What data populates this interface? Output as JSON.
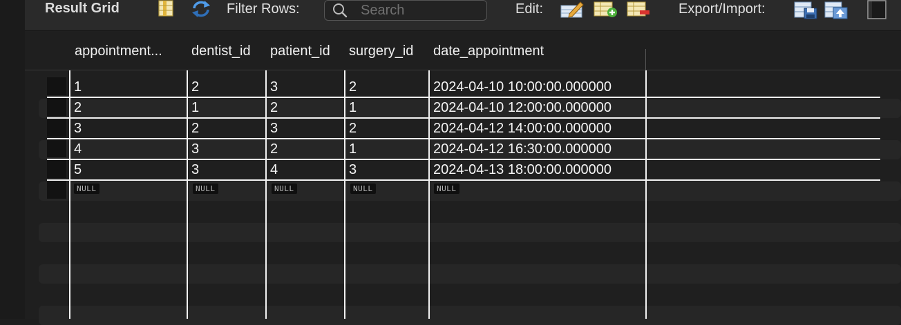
{
  "toolbar": {
    "title": "Result Grid",
    "filter_label": "Filter Rows:",
    "search_placeholder": "Search",
    "edit_label": "Edit:",
    "export_label": "Export/Import:"
  },
  "grid": {
    "columns": [
      "appointment...",
      "dentist_id",
      "patient_id",
      "surgery_id",
      "date_appointment"
    ],
    "rows": [
      [
        "1",
        "2",
        "3",
        "2",
        "2024-04-10 10:00:00.000000"
      ],
      [
        "2",
        "1",
        "2",
        "1",
        "2024-04-10 12:00:00.000000"
      ],
      [
        "3",
        "2",
        "3",
        "2",
        "2024-04-12 14:00:00.000000"
      ],
      [
        "4",
        "3",
        "2",
        "1",
        "2024-04-12 16:30:00.000000"
      ],
      [
        "5",
        "3",
        "4",
        "3",
        "2024-04-13 18:00:00.000000"
      ]
    ],
    "null_row": [
      "NULL",
      "NULL",
      "NULL",
      "NULL",
      "NULL"
    ]
  },
  "icons": {
    "result_grid": "grid-columns-icon",
    "refresh": "refresh-icon",
    "search": "search-icon",
    "edit_row": "edit-row-icon",
    "add_row": "add-row-icon",
    "delete_row": "delete-row-icon",
    "export": "export-icon",
    "import": "import-icon",
    "panel_toggle": "panel-toggle-icon"
  },
  "colors": {
    "background": "#1e1e1e",
    "toolbar": "#2a2a2a",
    "grid_lines": "#f2f2f2",
    "text": "#f4f4f4",
    "null_badge": "#0f0f0f"
  }
}
